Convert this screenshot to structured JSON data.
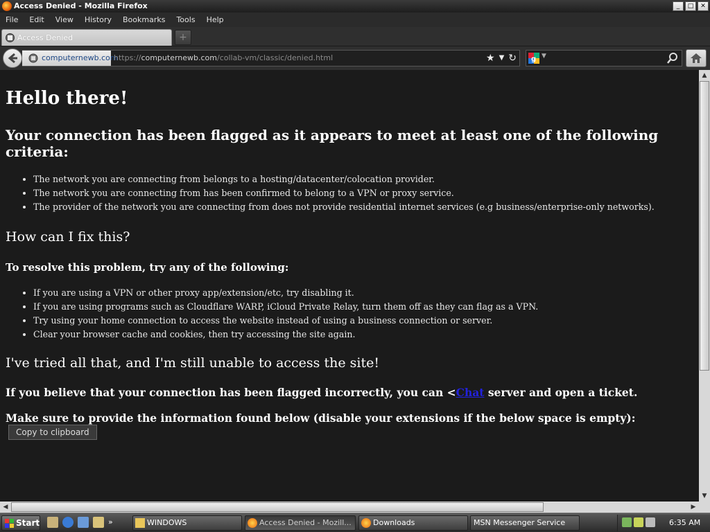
{
  "window": {
    "title": "Access Denied - Mozilla Firefox",
    "buttons": [
      "_",
      "□",
      "✕"
    ]
  },
  "menu": [
    "File",
    "Edit",
    "View",
    "History",
    "Bookmarks",
    "Tools",
    "Help"
  ],
  "tabs": [
    {
      "label": "Access Denied"
    }
  ],
  "nav": {
    "identity": "computernewb.com",
    "url_prefix": "https://",
    "url_host": "computernewb.com",
    "url_path": "/collab-vm/classic/denied.html"
  },
  "page": {
    "heading": "Hello there!",
    "flagged_heading": "Your connection has been flagged as it appears to meet at least one of the following criteria:",
    "criteria": [
      "The network you are connecting from belongs to a hosting/datacenter/colocation provider.",
      "The network you are connecting from has been confirmed to belong to a VPN or proxy service.",
      "The provider of the network you are connecting from does not provide residential internet services (e.g business/enterprise-only networks)."
    ],
    "fix_heading": "How can I fix this?",
    "resolve_heading": "To resolve this problem, try any of the following:",
    "fixes": [
      "If you are using a VPN or other proxy app/extension/etc, try disabling it.",
      "If you are using programs such as Cloudflare WARP, iCloud Private Relay, turn them off as they can flag as a VPN.",
      "Try using your home connection to access the website instead of using a business connection or server.",
      "Clear your browser cache and cookies, then try accessing the site again."
    ],
    "tried_heading": "I've tried all that, and I'm still unable to access the site!",
    "believe_before": "If you believe that your connection has been flagged incorrectly, you can <",
    "believe_link": "Chat",
    "believe_after": " server and open a ticket.",
    "provide_text": "Make sure to provide the information found below (disable your extensions if the below space is empty):",
    "copy_button": "Copy to clipboard"
  },
  "taskbar": {
    "start": "Start",
    "tasks": [
      "WINDOWS",
      "Access Denied - Mozill...",
      "Downloads",
      "MSN Messenger Service"
    ],
    "clock": "6:35 AM"
  },
  "colors": {
    "page_bg": "#1b1b1b",
    "link": "#2222dd",
    "chrome_bg": "#2f2f2f"
  }
}
